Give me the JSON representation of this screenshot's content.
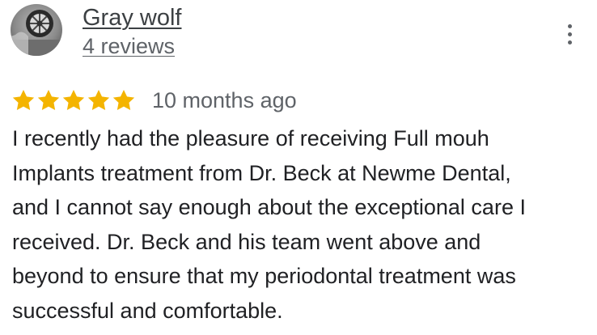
{
  "reviewer": {
    "name": "Gray wolf",
    "review_count": "4 reviews",
    "avatar_icon": "profile-photo-car-wheel"
  },
  "menu": {
    "icon": "more-vertical-icon"
  },
  "rating": {
    "stars": 5,
    "max_stars": 5,
    "star_color": "#F4B400",
    "time": "10 months ago"
  },
  "review": {
    "lines": [
      "I recently had the pleasure of receiving Full mouh",
      "Implants treatment from Dr. Beck at Newme Dental,",
      "and I cannot say enough about the exceptional care I",
      "received. Dr. Beck and his team went above and",
      "beyond to ensure that my periodontal treatment was",
      "successful and comfortable."
    ]
  }
}
